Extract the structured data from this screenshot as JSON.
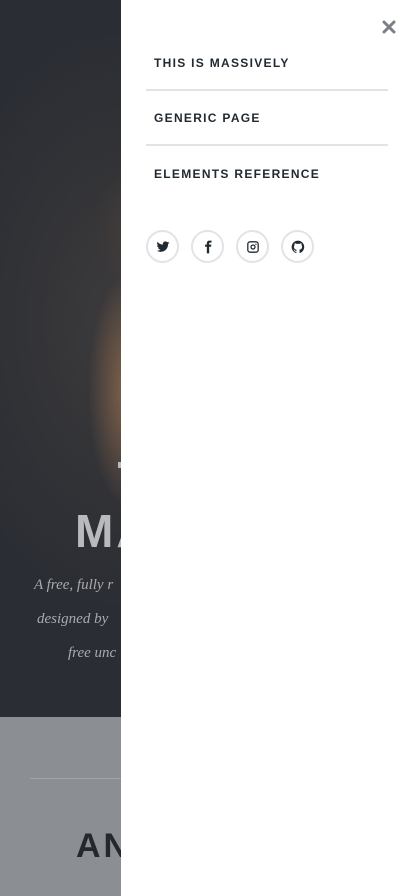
{
  "background": {
    "hero_title_partial": "MA",
    "hero_lines": [
      "A free, fully r",
      "designed by",
      "free unc"
    ],
    "section_heading_partial": "AN"
  },
  "menu": {
    "items": [
      {
        "label": "THIS IS MASSIVELY"
      },
      {
        "label": "GENERIC PAGE"
      },
      {
        "label": "ELEMENTS REFERENCE"
      }
    ],
    "socials": [
      {
        "icon": "twitter-icon"
      },
      {
        "icon": "facebook-icon"
      },
      {
        "icon": "instagram-icon"
      },
      {
        "icon": "github-icon"
      }
    ],
    "close_icon": "close-icon"
  },
  "colors": {
    "menu_bg": "#ffffff",
    "menu_text": "#212931",
    "divider": "#e2e3e5"
  }
}
